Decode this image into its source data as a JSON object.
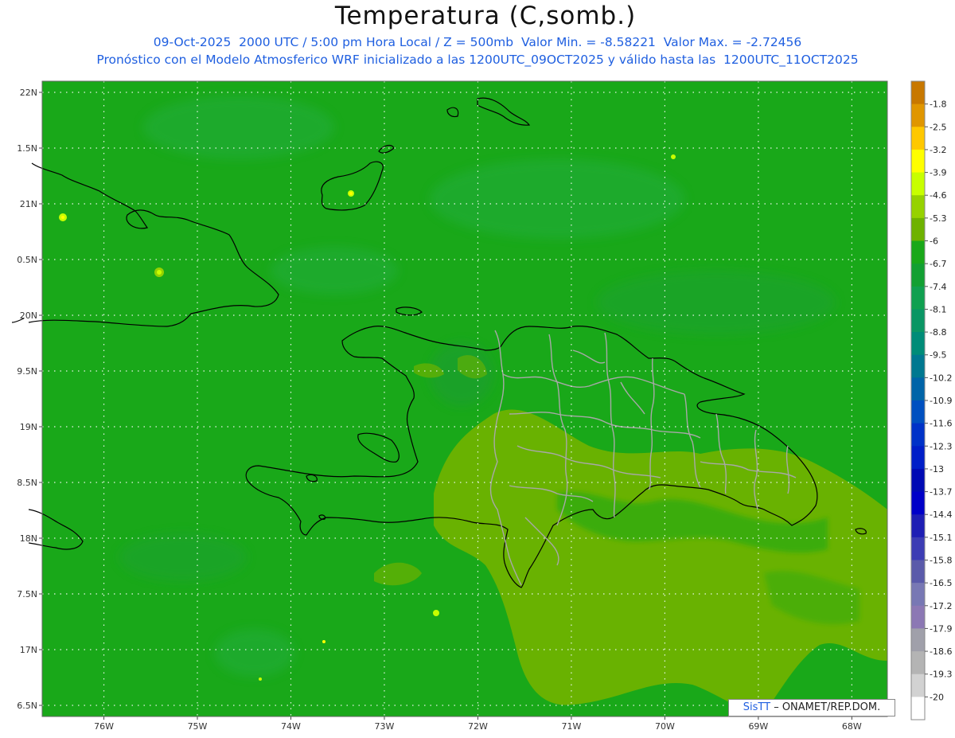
{
  "title": "Temperatura (C,somb.)",
  "subtitle_line1": "09-Oct-2025  2000 UTC / 5:00 pm Hora Local / Z = 500mb  Valor Min. = -8.58221  Valor Max. = -2.72456",
  "subtitle_line2": "Pronóstico con el Modelo Atmosferico WRF inicializado a las 1200UTC_09OCT2025 y válido hasta las  1200UTC_11OCT2025",
  "credit": {
    "brand": "SisTT",
    "separator": " – ",
    "org": "ONAMET/REP.DOM."
  },
  "map": {
    "variable": "Temperatura",
    "units": "C",
    "level": "500mb",
    "lat_labels": [
      "22N",
      "1.5N",
      "21N",
      "0.5N",
      "20N",
      "9.5N",
      "19N",
      "8.5N",
      "18N",
      "7.5N",
      "17N",
      "6.5N"
    ],
    "lat_values": [
      22,
      21.5,
      21,
      20.5,
      20,
      19.5,
      19,
      18.5,
      18,
      17.5,
      17,
      16.5
    ],
    "lon_labels": [
      "76W",
      "75W",
      "74W",
      "73W",
      "72W",
      "71W",
      "70W",
      "69W",
      "68W"
    ],
    "lon_values": [
      -76,
      -75,
      -74,
      -73,
      -72,
      -71,
      -70,
      -69,
      -68
    ],
    "lat_range": [
      16.4,
      22.1
    ],
    "lon_range": [
      -76.66,
      -67.62
    ],
    "gridlines": "dotted white",
    "base_color": "#19a819",
    "warm_region_color": "#6eb200"
  },
  "colorbar": {
    "labels": [
      "-1.8",
      "-2.5",
      "-3.2",
      "-3.9",
      "-4.6",
      "-5.3",
      "-6",
      "-6.7",
      "-7.4",
      "-8.1",
      "-8.8",
      "-9.5",
      "-10.2",
      "-10.9",
      "-11.6",
      "-12.3",
      "-13",
      "-13.7",
      "-14.4",
      "-15.1",
      "-15.8",
      "-16.5",
      "-17.2",
      "-17.9",
      "-18.6",
      "-19.3",
      "-20"
    ],
    "colors": [
      "#c87800",
      "#e09600",
      "#ffc800",
      "#ffff00",
      "#c8ff00",
      "#96d200",
      "#6eb200",
      "#19a819",
      "#12a032",
      "#10a050",
      "#0a9664",
      "#008c78",
      "#007890",
      "#0064a8",
      "#0050c0",
      "#0032c8",
      "#001ec8",
      "#000ab4",
      "#0000c8",
      "#1e1eb4",
      "#3c3cb4",
      "#5a5aaa",
      "#7878b4",
      "#8c78b4",
      "#a0a0aa",
      "#b4b4b4",
      "#d2d2d2",
      "#ffffff"
    ]
  }
}
